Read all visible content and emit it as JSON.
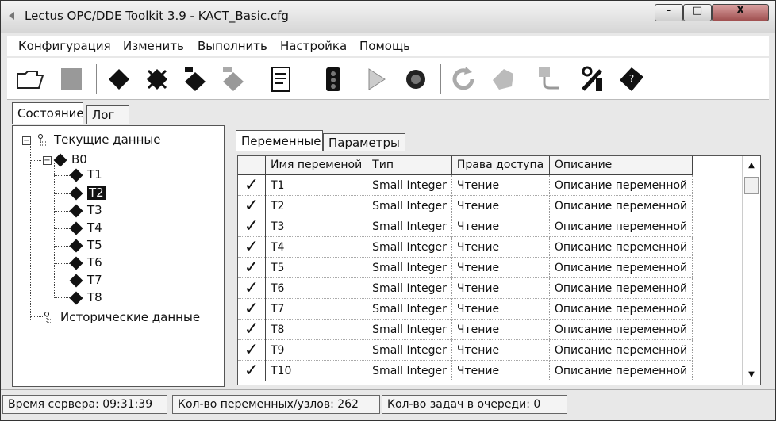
{
  "window": {
    "title": "Lectus OPC/DDE Toolkit 3.9 - KACT_Basic.cfg",
    "controls": {
      "close": "X"
    }
  },
  "menu": [
    "Конфигурация",
    "Изменить",
    "Выполнить",
    "Настройка",
    "Помощь"
  ],
  "toolbar_icons": [
    "open-folder-icon",
    "save-icon",
    "add-node-icon",
    "delete-icon",
    "add-variable-icon",
    "variable-disabled-icon",
    "edit-document-icon",
    "run-icon",
    "play-icon",
    "stop-icon",
    "refresh-icon",
    "erase-icon",
    "connection-icon",
    "tools-icon",
    "help-book-icon"
  ],
  "left_tabs": [
    "Состояние",
    "Лог"
  ],
  "tree": {
    "root": "Текущие данные",
    "node": "B0",
    "items": [
      "T1",
      "T2",
      "T3",
      "T4",
      "T5",
      "T6",
      "T7",
      "T8"
    ],
    "selected": "T2",
    "historical": "Исторические данные"
  },
  "right_tabs": [
    "Переменные",
    "Параметры"
  ],
  "table": {
    "columns": [
      "Имя переменой",
      "Тип",
      "Права доступа",
      "Описание"
    ],
    "check_symbol": "✓",
    "rows": [
      {
        "name": "T1",
        "type": "Small Integer",
        "access": "Чтение",
        "desc": "Описание переменной"
      },
      {
        "name": "T2",
        "type": "Small Integer",
        "access": "Чтение",
        "desc": "Описание переменной"
      },
      {
        "name": "T3",
        "type": "Small Integer",
        "access": "Чтение",
        "desc": "Описание переменной"
      },
      {
        "name": "T4",
        "type": "Small Integer",
        "access": "Чтение",
        "desc": "Описание переменной"
      },
      {
        "name": "T5",
        "type": "Small Integer",
        "access": "Чтение",
        "desc": "Описание переменной"
      },
      {
        "name": "T6",
        "type": "Small Integer",
        "access": "Чтение",
        "desc": "Описание переменной"
      },
      {
        "name": "T7",
        "type": "Small Integer",
        "access": "Чтение",
        "desc": "Описание переменной"
      },
      {
        "name": "T8",
        "type": "Small Integer",
        "access": "Чтение",
        "desc": "Описание переменной"
      },
      {
        "name": "T9",
        "type": "Small Integer",
        "access": "Чтение",
        "desc": "Описание переменной"
      },
      {
        "name": "T10",
        "type": "Small Integer",
        "access": "Чтение",
        "desc": "Описание переменной"
      }
    ]
  },
  "status": {
    "server_time": "Время сервера: 09:31:39",
    "vars_nodes": "Кол-во переменных/узлов: 262",
    "queue": "Кол-во задач в очереди: 0"
  }
}
